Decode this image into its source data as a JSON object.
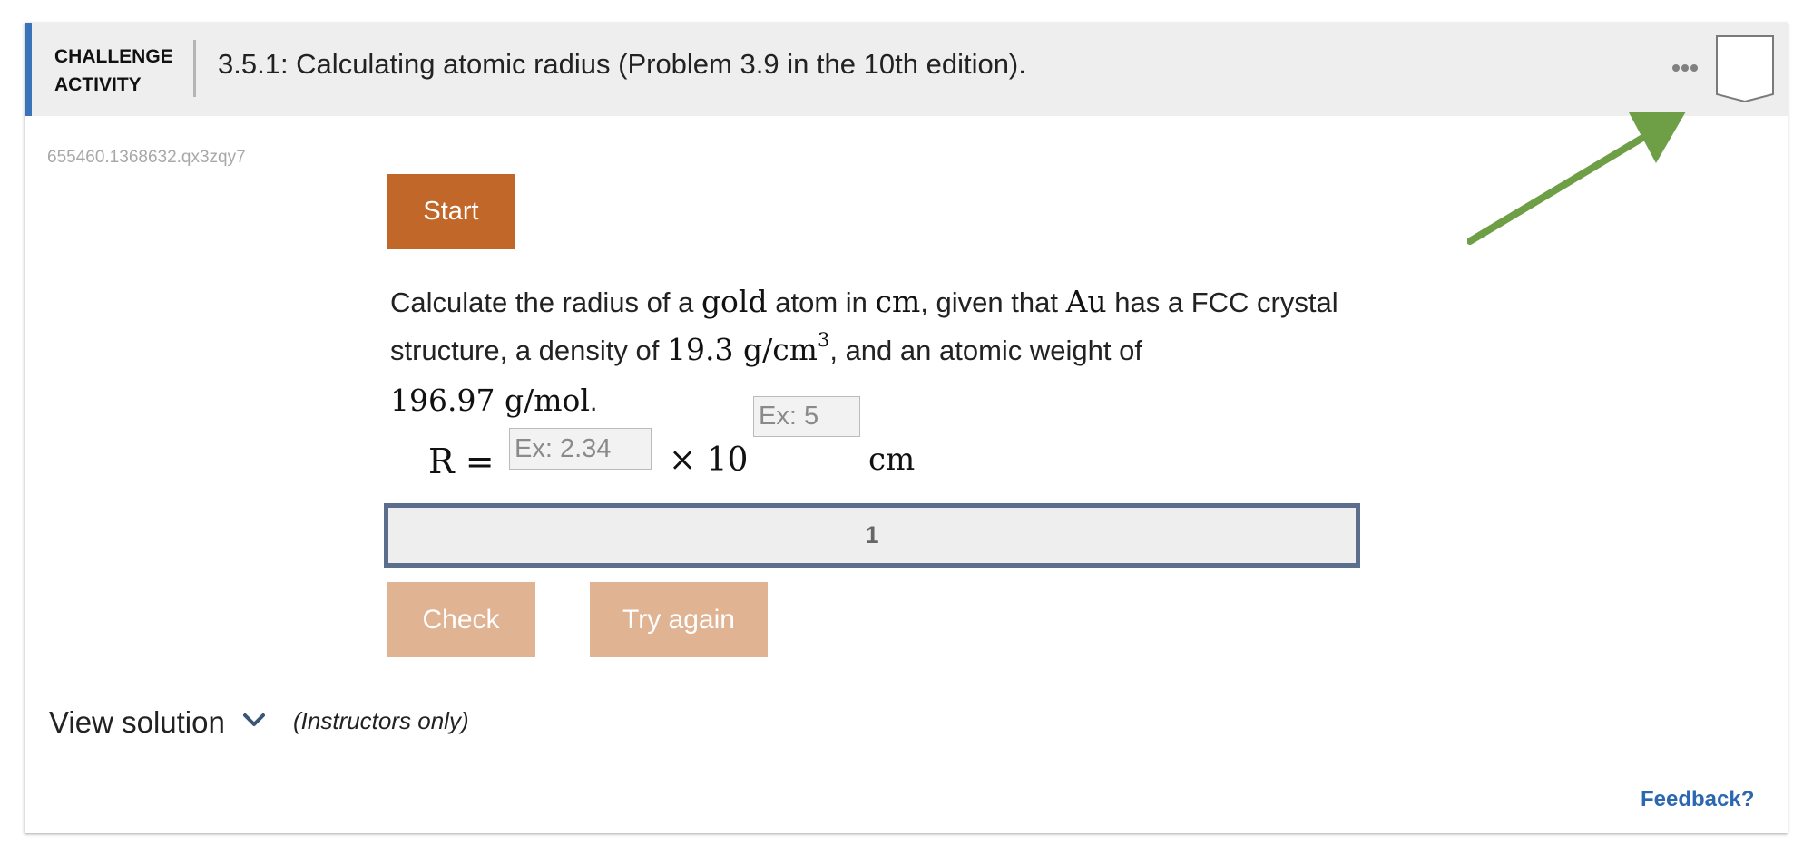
{
  "header": {
    "type_label_line1": "CHALLENGE",
    "type_label_line2": "ACTIVITY",
    "title": "3.5.1: Calculating atomic radius (Problem 3.9 in the 10th edition).",
    "accent_color": "#3a73b9",
    "more_icon": "more-horizontal-icon",
    "bookmark_icon": "bookmark-icon"
  },
  "annotation": {
    "arrow_color": "#6e9e45",
    "arrow_icon": "arrow-icon"
  },
  "activity_id": "655460.1368632.qx3zqy7",
  "start_button": {
    "label": "Start",
    "color": "#c1672a"
  },
  "question": {
    "t1": "Calculate the radius of a ",
    "m_gold": "gold",
    "t2": " atom in ",
    "m_cm": "cm",
    "t3": ", given that ",
    "m_au": "Au",
    "t4": " has a FCC crystal structure, a density of ",
    "m_density": "19.3 g/cm",
    "m_density_exp": "3",
    "t5": ", and an atomic weight of ",
    "m_weight": "196.97 g/mol",
    "t6": "."
  },
  "answer": {
    "variable": "R =",
    "mantissa_placeholder": "Ex: 2.34",
    "mantissa_value": "",
    "times_ten": "× 10",
    "exponent_placeholder": "Ex: 5",
    "exponent_value": "",
    "unit": "cm"
  },
  "progress": {
    "steps": [
      "1"
    ],
    "border_color": "#5b6e8c"
  },
  "actions": {
    "check_label": "Check",
    "try_again_label": "Try again",
    "disabled_color": "#e0b393"
  },
  "solution": {
    "label": "View solution",
    "note": "(Instructors only)",
    "chevron_icon": "chevron-down-icon"
  },
  "feedback": {
    "label": "Feedback?",
    "color": "#2c67b1"
  }
}
